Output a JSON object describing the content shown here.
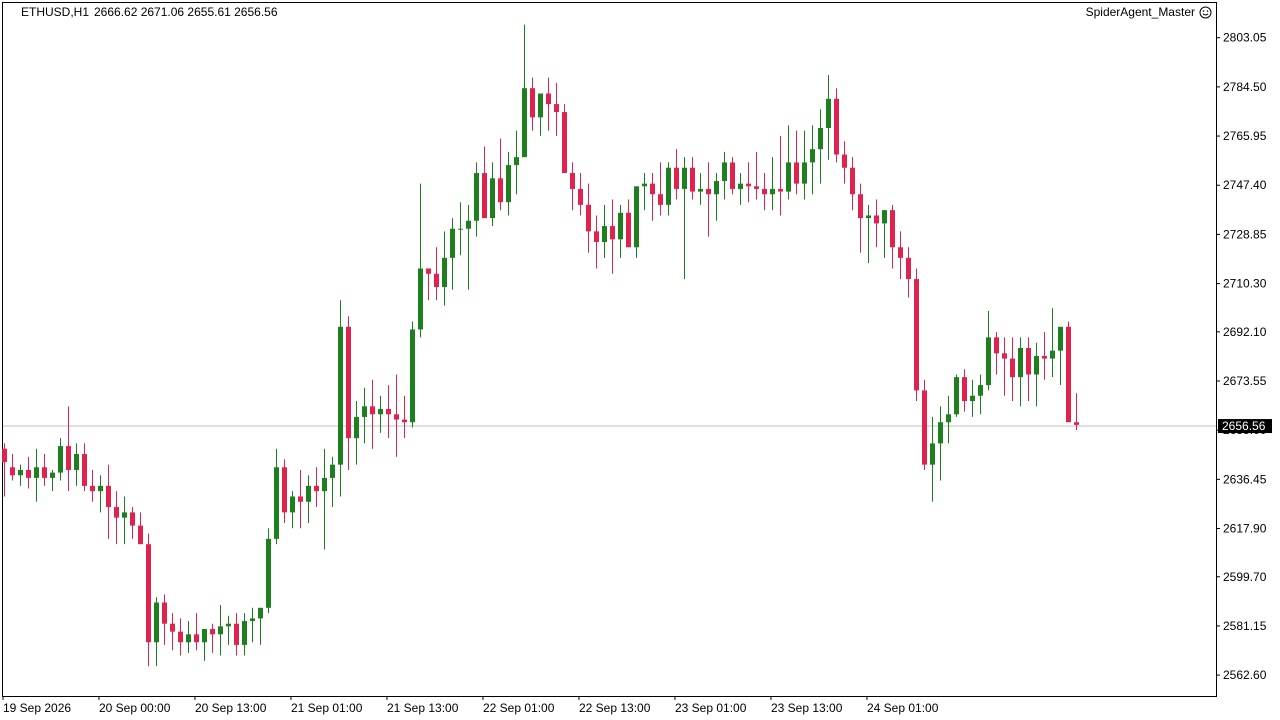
{
  "header": {
    "symbol": "ETHUSD,H1",
    "ohlc": "2666.62 2671.06 2655.61 2656.56",
    "agent_name": "SpiderAgent_Master"
  },
  "colors": {
    "bull": "#1e7f1e",
    "bear": "#e0234e",
    "axis": "#000000",
    "current_line": "#c0c0c0",
    "price_tag_bg": "#000000",
    "price_tag_text": "#ffffff"
  },
  "chart_data": {
    "type": "candlestick",
    "symbol": "ETHUSD",
    "timeframe": "H1",
    "y_ticks": [
      "2803.05",
      "2784.50",
      "2765.95",
      "2747.40",
      "2728.85",
      "2710.30",
      "2692.10",
      "2673.55",
      "2655.00",
      "2636.45",
      "2617.90",
      "2599.70",
      "2581.15",
      "2562.60"
    ],
    "ylim": [
      2558.5,
      2813.5
    ],
    "x_labels": [
      "19 Sep 2026",
      "20 Sep 00:00",
      "20 Sep 13:00",
      "21 Sep 01:00",
      "21 Sep 13:00",
      "22 Sep 01:00",
      "22 Sep 13:00",
      "23 Sep 01:00",
      "23 Sep 13:00",
      "24 Sep 01:00"
    ],
    "current_price": "2656.56",
    "candles": [
      [
        2648,
        2650,
        2630,
        2643
      ],
      [
        2641,
        2646,
        2636,
        2638
      ],
      [
        2638,
        2642,
        2634,
        2640
      ],
      [
        2640,
        2645,
        2633,
        2637
      ],
      [
        2637,
        2648,
        2628,
        2641
      ],
      [
        2641,
        2646,
        2634,
        2637
      ],
      [
        2637,
        2640,
        2632,
        2639
      ],
      [
        2639,
        2652,
        2636,
        2649
      ],
      [
        2649,
        2664,
        2632,
        2640
      ],
      [
        2640,
        2650,
        2634,
        2646
      ],
      [
        2646,
        2650,
        2632,
        2634
      ],
      [
        2634,
        2640,
        2628,
        2632
      ],
      [
        2632,
        2638,
        2624,
        2634
      ],
      [
        2634,
        2642,
        2614,
        2626
      ],
      [
        2626,
        2632,
        2612,
        2622
      ],
      [
        2622,
        2630,
        2612,
        2624
      ],
      [
        2624,
        2626,
        2614,
        2619
      ],
      [
        2619,
        2624,
        2612,
        2612
      ],
      [
        2612,
        2616,
        2566,
        2575
      ],
      [
        2575,
        2592,
        2566,
        2590
      ],
      [
        2590,
        2593,
        2574,
        2582
      ],
      [
        2582,
        2586,
        2572,
        2579
      ],
      [
        2579,
        2584,
        2570,
        2575
      ],
      [
        2575,
        2583,
        2571,
        2578
      ],
      [
        2578,
        2586,
        2572,
        2575
      ],
      [
        2575,
        2580,
        2568,
        2580
      ],
      [
        2580,
        2582,
        2571,
        2578
      ],
      [
        2578,
        2589,
        2570,
        2581
      ],
      [
        2581,
        2585,
        2574,
        2582
      ],
      [
        2582,
        2586,
        2570,
        2574
      ],
      [
        2574,
        2586,
        2570,
        2583
      ],
      [
        2583,
        2588,
        2575,
        2584
      ],
      [
        2584,
        2586,
        2574,
        2588
      ],
      [
        2588,
        2618,
        2586,
        2614
      ],
      [
        2614,
        2648,
        2612,
        2641
      ],
      [
        2641,
        2644,
        2620,
        2624
      ],
      [
        2624,
        2632,
        2618,
        2630
      ],
      [
        2630,
        2640,
        2618,
        2628
      ],
      [
        2628,
        2638,
        2620,
        2634
      ],
      [
        2634,
        2641,
        2626,
        2632
      ],
      [
        2632,
        2648,
        2610,
        2637
      ],
      [
        2637,
        2645,
        2626,
        2642
      ],
      [
        2642,
        2704,
        2630,
        2694
      ],
      [
        2694,
        2698,
        2640,
        2652
      ],
      [
        2652,
        2666,
        2642,
        2660
      ],
      [
        2660,
        2671,
        2650,
        2664
      ],
      [
        2664,
        2674,
        2648,
        2661
      ],
      [
        2661,
        2668,
        2654,
        2663
      ],
      [
        2663,
        2672,
        2652,
        2661
      ],
      [
        2661,
        2676,
        2645,
        2659
      ],
      [
        2659,
        2668,
        2652,
        2658
      ],
      [
        2658,
        2696,
        2656,
        2693
      ],
      [
        2693,
        2748,
        2690,
        2716
      ],
      [
        2716,
        2716,
        2704,
        2714
      ],
      [
        2714,
        2724,
        2704,
        2709
      ],
      [
        2709,
        2730,
        2702,
        2720
      ],
      [
        2720,
        2735,
        2708,
        2731
      ],
      [
        2731,
        2741,
        2721,
        2731
      ],
      [
        2731,
        2740,
        2708,
        2734
      ],
      [
        2734,
        2756,
        2728,
        2752
      ],
      [
        2752,
        2762,
        2735,
        2735
      ],
      [
        2735,
        2756,
        2732,
        2750
      ],
      [
        2750,
        2765,
        2738,
        2741
      ],
      [
        2741,
        2760,
        2736,
        2755
      ],
      [
        2755,
        2768,
        2744,
        2758
      ],
      [
        2758,
        2808,
        2758,
        2784
      ],
      [
        2784,
        2788,
        2768,
        2773
      ],
      [
        2773,
        2780,
        2766,
        2782
      ],
      [
        2782,
        2788,
        2768,
        2778
      ],
      [
        2778,
        2786,
        2766,
        2775
      ],
      [
        2775,
        2778,
        2752,
        2752
      ],
      [
        2752,
        2756,
        2738,
        2746
      ],
      [
        2746,
        2752,
        2736,
        2740
      ],
      [
        2740,
        2748,
        2722,
        2730
      ],
      [
        2730,
        2736,
        2716,
        2726
      ],
      [
        2726,
        2740,
        2720,
        2732
      ],
      [
        2732,
        2742,
        2714,
        2727
      ],
      [
        2727,
        2740,
        2720,
        2737
      ],
      [
        2737,
        2742,
        2724,
        2724
      ],
      [
        2724,
        2740,
        2720,
        2747
      ],
      [
        2747,
        2752,
        2738,
        2748
      ],
      [
        2748,
        2752,
        2734,
        2744
      ],
      [
        2744,
        2756,
        2736,
        2740
      ],
      [
        2740,
        2756,
        2736,
        2754
      ],
      [
        2754,
        2761,
        2742,
        2746
      ],
      [
        2746,
        2758,
        2712,
        2754
      ],
      [
        2754,
        2758,
        2742,
        2745
      ],
      [
        2745,
        2752,
        2740,
        2746
      ],
      [
        2746,
        2756,
        2728,
        2744
      ],
      [
        2744,
        2752,
        2734,
        2749
      ],
      [
        2749,
        2760,
        2742,
        2756
      ],
      [
        2756,
        2758,
        2744,
        2746
      ],
      [
        2746,
        2752,
        2740,
        2748
      ],
      [
        2748,
        2756,
        2741,
        2747
      ],
      [
        2747,
        2760,
        2742,
        2746
      ],
      [
        2746,
        2752,
        2738,
        2744
      ],
      [
        2744,
        2758,
        2738,
        2746
      ],
      [
        2746,
        2766,
        2736,
        2745
      ],
      [
        2745,
        2770,
        2742,
        2756
      ],
      [
        2756,
        2768,
        2744,
        2748
      ],
      [
        2748,
        2768,
        2742,
        2756
      ],
      [
        2756,
        2770,
        2744,
        2761
      ],
      [
        2761,
        2776,
        2748,
        2769
      ],
      [
        2769,
        2789,
        2757,
        2780
      ],
      [
        2780,
        2784,
        2756,
        2759
      ],
      [
        2759,
        2764,
        2748,
        2754
      ],
      [
        2754,
        2758,
        2738,
        2744
      ],
      [
        2744,
        2748,
        2722,
        2735
      ],
      [
        2735,
        2740,
        2718,
        2736
      ],
      [
        2736,
        2742,
        2724,
        2733
      ],
      [
        2733,
        2738,
        2720,
        2738
      ],
      [
        2738,
        2740,
        2716,
        2724
      ],
      [
        2724,
        2730,
        2712,
        2720
      ],
      [
        2720,
        2724,
        2705,
        2712
      ],
      [
        2712,
        2716,
        2666,
        2670
      ],
      [
        2670,
        2674,
        2640,
        2642
      ],
      [
        2642,
        2660,
        2628,
        2650
      ],
      [
        2650,
        2664,
        2636,
        2658
      ],
      [
        2658,
        2668,
        2650,
        2661
      ],
      [
        2661,
        2676,
        2660,
        2675
      ],
      [
        2675,
        2678,
        2662,
        2666
      ],
      [
        2666,
        2674,
        2660,
        2668
      ],
      [
        2668,
        2676,
        2661,
        2672
      ],
      [
        2672,
        2700,
        2670,
        2690
      ],
      [
        2690,
        2692,
        2676,
        2684
      ],
      [
        2684,
        2690,
        2668,
        2682
      ],
      [
        2682,
        2690,
        2666,
        2675
      ],
      [
        2675,
        2690,
        2664,
        2686
      ],
      [
        2686,
        2690,
        2666,
        2676
      ],
      [
        2676,
        2688,
        2664,
        2683
      ],
      [
        2683,
        2692,
        2674,
        2682
      ],
      [
        2682,
        2701,
        2675,
        2685
      ],
      [
        2685,
        2692,
        2672,
        2694
      ],
      [
        2694,
        2696,
        2664,
        2658
      ],
      [
        2658,
        2669,
        2655,
        2657
      ]
    ]
  }
}
